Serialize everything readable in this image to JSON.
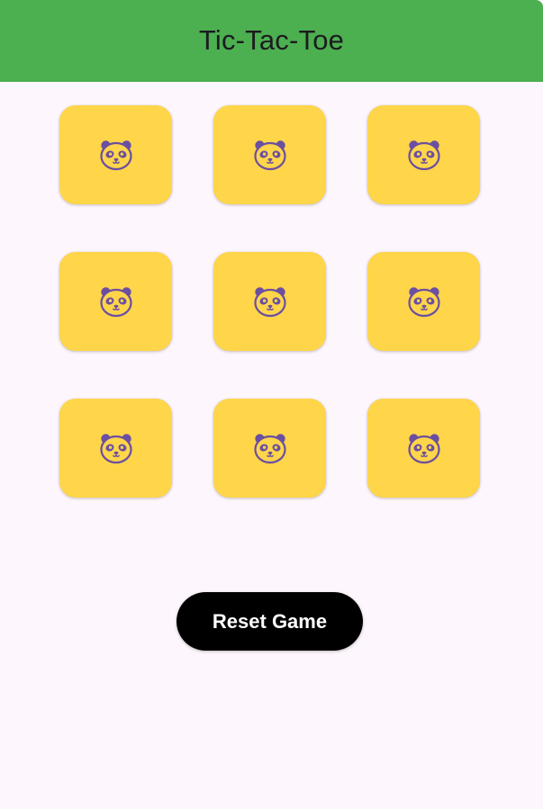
{
  "app_bar": {
    "title": "Tic-Tac-Toe"
  },
  "board": {
    "cells": [
      {
        "icon": "panda-icon"
      },
      {
        "icon": "panda-icon"
      },
      {
        "icon": "panda-icon"
      },
      {
        "icon": "panda-icon"
      },
      {
        "icon": "panda-icon"
      },
      {
        "icon": "panda-icon"
      },
      {
        "icon": "panda-icon"
      },
      {
        "icon": "panda-icon"
      },
      {
        "icon": "panda-icon"
      }
    ]
  },
  "actions": {
    "reset_label": "Reset Game"
  },
  "colors": {
    "app_bar": "#4CAF50",
    "background": "#FDF6FC",
    "cell": "#FFD54A",
    "icon": "#6B4FA0",
    "button": "#000000",
    "button_text": "#FFFFFF"
  }
}
